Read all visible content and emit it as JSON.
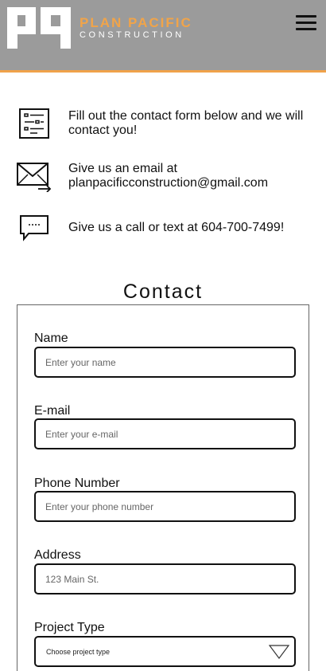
{
  "header": {
    "logo_name": "PLAN PACIFIC",
    "logo_sub": "CONSTRUCTION",
    "accent_color": "#f1a449",
    "background_color": "#9b9b9b",
    "menu_icon": "hamburger-menu-icon"
  },
  "info": [
    {
      "icon": "form-list-icon",
      "text": "Fill out the contact form below and we will contact you!"
    },
    {
      "icon": "email-forward-icon",
      "text": "Give us an email at planpacificconstruction@gmail.com"
    },
    {
      "icon": "chat-bubble-icon",
      "text": "Give us a call or text at 604-700-7499!"
    }
  ],
  "contact": {
    "title": "Contact",
    "fields": {
      "name": {
        "label": "Name",
        "placeholder": "Enter your name"
      },
      "email": {
        "label": "E-mail",
        "placeholder": "Enter your e-mail"
      },
      "phone": {
        "label": "Phone Number",
        "placeholder": "Enter your phone number"
      },
      "address": {
        "label": "Address",
        "placeholder": "123 Main St."
      },
      "project_type": {
        "label": "Project Type",
        "selected": "Choose project type"
      }
    }
  }
}
